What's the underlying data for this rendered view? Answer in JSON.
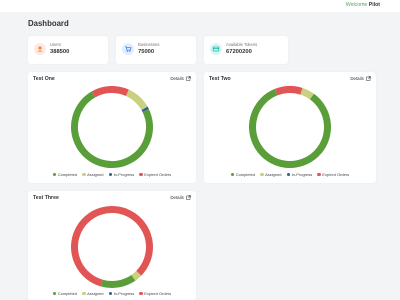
{
  "header": {
    "welcome_prefix": "Welcome",
    "user_name": "Pilot"
  },
  "page": {
    "title": "Dashboard"
  },
  "stats": [
    {
      "label": "Users",
      "value": "388500",
      "icon": "user-icon",
      "icon_color": "#f0883e",
      "icon_bg": "#fdebe0"
    },
    {
      "label": "Businesses",
      "value": "75000",
      "icon": "cart-icon",
      "icon_color": "#3b82f6",
      "icon_bg": "#e2ecfd"
    },
    {
      "label": "Available Tokens",
      "value": "67200200",
      "icon": "card-icon",
      "icon_color": "#14b8a6",
      "icon_bg": "#d9f5f1"
    }
  ],
  "colors": {
    "completed": "#5a9e3a",
    "assigned": "#c9d17f",
    "in_progress": "#2e5e99",
    "expired": "#e25555"
  },
  "legend": [
    {
      "label": "Completed",
      "key": "completed"
    },
    {
      "label": "Assigned",
      "key": "assigned"
    },
    {
      "label": "In-Progress",
      "key": "in_progress"
    },
    {
      "label": "Expired Orders",
      "key": "expired"
    }
  ],
  "details_label": "Details",
  "chart_data": [
    {
      "type": "pie",
      "title": "Test One",
      "labels": [
        "Completed",
        "Assigned",
        "In-Progress",
        "Expired Orders"
      ],
      "values": [
        74,
        10,
        1,
        15
      ]
    },
    {
      "type": "pie",
      "title": "Test Two",
      "labels": [
        "Completed",
        "Assigned",
        "In-Progress",
        "Expired Orders"
      ],
      "values": [
        84,
        5,
        0,
        11
      ]
    },
    {
      "type": "pie",
      "title": "Test Three",
      "labels": [
        "Completed",
        "Assigned",
        "In-Progress",
        "Expired Orders"
      ],
      "values": [
        14,
        3,
        0,
        83
      ]
    }
  ]
}
